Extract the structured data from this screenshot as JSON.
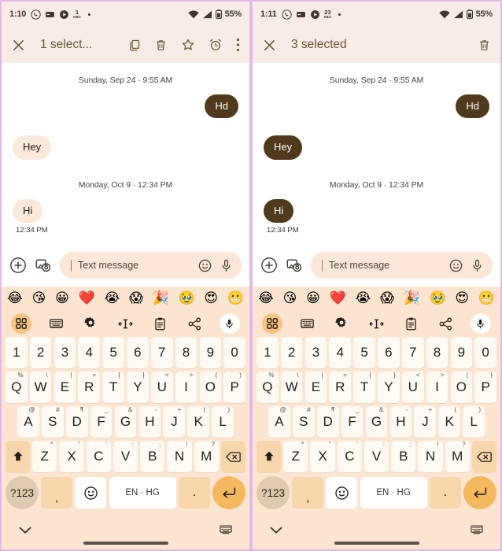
{
  "panels": [
    {
      "id": "left",
      "status": {
        "time": "1:10",
        "netspeed_value": "1",
        "netspeed_unit": "KB/s",
        "battery": "55%",
        "icons": [
          "whatsapp-icon",
          "wallet-icon",
          "play-icon"
        ]
      },
      "actionbar": {
        "close_label": "close-icon",
        "title": "1 select...",
        "actions": [
          "copy-icon",
          "delete-icon",
          "star-icon",
          "alarm-icon",
          "overflow-icon"
        ]
      },
      "conversation": {
        "groups": [
          {
            "daystamp": "Sunday, Sep 24 · 9:55 AM",
            "messages": [
              {
                "text": "Hd",
                "side": "out",
                "selected": true,
                "time": ""
              },
              {
                "text": "Hey",
                "side": "in",
                "selected": false,
                "time": ""
              }
            ]
          },
          {
            "daystamp": "Monday, Oct 9 · 12:34 PM",
            "messages": [
              {
                "text": "Hi",
                "side": "in",
                "selected": false,
                "time": "12:34 PM"
              }
            ]
          }
        ]
      }
    },
    {
      "id": "right",
      "status": {
        "time": "1:11",
        "netspeed_value": "23",
        "netspeed_unit": "KB/s",
        "battery": "55%",
        "icons": [
          "whatsapp-icon",
          "wallet-icon",
          "play-icon"
        ]
      },
      "actionbar": {
        "close_label": "close-icon",
        "title": "3 selected",
        "actions": [
          "delete-icon"
        ]
      },
      "conversation": {
        "groups": [
          {
            "daystamp": "Sunday, Sep 24 · 9:55 AM",
            "messages": [
              {
                "text": "Hd",
                "side": "out",
                "selected": true,
                "time": ""
              },
              {
                "text": "Hey",
                "side": "in",
                "selected": true,
                "time": ""
              }
            ]
          },
          {
            "daystamp": "Monday, Oct 9 · 12:34 PM",
            "messages": [
              {
                "text": "Hi",
                "side": "in",
                "selected": true,
                "time": "12:34 PM"
              }
            ]
          }
        ]
      }
    }
  ],
  "compose": {
    "add_icon": "plus-circle-icon",
    "gallery_icon": "image-camera-icon",
    "placeholder": "Text message",
    "emoji_icon": "emoji-smile-icon",
    "mic_icon": "microphone-icon"
  },
  "emoji_strip": [
    "😂",
    "😘",
    "😀",
    "❤️",
    "😭",
    "😱",
    "🎉",
    "🥹",
    "😍",
    "😬"
  ],
  "keyboard": {
    "toolbar": [
      "grid-apps-icon",
      "keyboard-icon",
      "settings-gear-icon",
      "text-cursor-icon",
      "clipboard-icon",
      "share-icon",
      "microphone-icon"
    ],
    "row_numbers": [
      {
        "main": "1"
      },
      {
        "main": "2"
      },
      {
        "main": "3"
      },
      {
        "main": "4"
      },
      {
        "main": "5"
      },
      {
        "main": "6"
      },
      {
        "main": "7"
      },
      {
        "main": "8"
      },
      {
        "main": "9"
      },
      {
        "main": "0"
      }
    ],
    "row_top": [
      {
        "main": "Q",
        "sup": "%"
      },
      {
        "main": "W",
        "sup": "\\"
      },
      {
        "main": "E",
        "sup": "|"
      },
      {
        "main": "R",
        "sup": "="
      },
      {
        "main": "T",
        "sup": "{"
      },
      {
        "main": "Y",
        "sup": "}"
      },
      {
        "main": "U",
        "sup": "<"
      },
      {
        "main": "I",
        "sup": ">"
      },
      {
        "main": "O",
        "sup": "("
      },
      {
        "main": "P",
        "sup": ")"
      }
    ],
    "row_home": [
      {
        "main": "A",
        "sup": "@"
      },
      {
        "main": "S",
        "sup": "#"
      },
      {
        "main": "D",
        "sup": "₹"
      },
      {
        "main": "F",
        "sup": "_"
      },
      {
        "main": "G",
        "sup": "&"
      },
      {
        "main": "H",
        "sup": "-"
      },
      {
        "main": "J",
        "sup": "+"
      },
      {
        "main": "K",
        "sup": "("
      },
      {
        "main": "L",
        "sup": ")"
      }
    ],
    "row_bottom": [
      {
        "main": "Z",
        "sup": "*"
      },
      {
        "main": "X",
        "sup": "\""
      },
      {
        "main": "C",
        "sup": "'"
      },
      {
        "main": "V",
        "sup": ":"
      },
      {
        "main": "B",
        "sup": ";"
      },
      {
        "main": "N",
        "sup": "!"
      },
      {
        "main": "M",
        "sup": "?"
      }
    ],
    "shift_icon": "shift-up-arrow-icon",
    "backspace_icon": "backspace-icon",
    "symbols_key": "?123",
    "comma_key": ",",
    "emoji_key_icon": "emoji-smile-icon",
    "space_label": "EN · HG",
    "period_key": ".",
    "enter_icon": "enter-return-icon"
  },
  "navbar": {
    "down_icon": "chevron-down-icon",
    "keyboard_switch_icon": "keyboard-switch-icon"
  },
  "colors": {
    "accent_brown": "#4f3a1b",
    "bubble_incoming": "#fbe9dc",
    "keyboard_bg": "#fbe5d0",
    "key_bg": "#fffaf4",
    "fn_key_bg": "#f8d6ac",
    "enter_key_bg": "#f4b85f",
    "appbar_bg": "#f7ece6",
    "title_color": "#6a5634",
    "frame_border": "#e2b8ea"
  }
}
